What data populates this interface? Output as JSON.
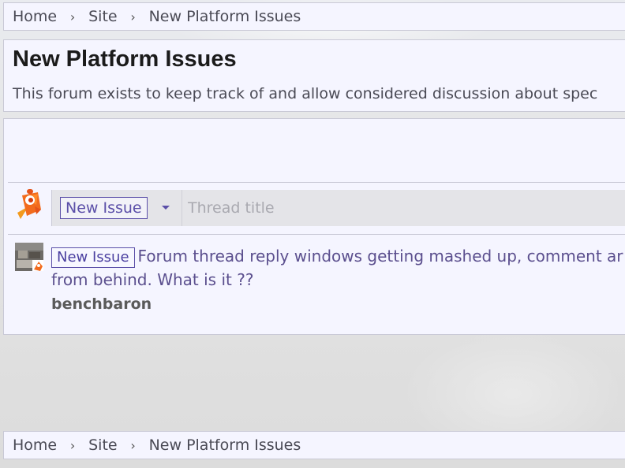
{
  "breadcrumb": {
    "items": [
      "Home",
      "Site",
      "New Platform Issues"
    ],
    "separator": "›"
  },
  "header": {
    "title": "New Platform Issues",
    "description": "This forum exists to keep track of and allow considered discussion about spec"
  },
  "composer": {
    "prefix_label": "New Issue",
    "title_placeholder": "Thread title",
    "avatar_icon": "orange-bird-icon"
  },
  "thread": {
    "prefix": "New Issue",
    "title_line1": "Forum thread reply windows getting mashed up, comment ar",
    "title_line2": "from behind. What is it ??",
    "author": "benchbaron"
  },
  "colors": {
    "panel_bg": "#f5f5ff",
    "border": "#c9c9d6",
    "accent": "#5b4fa8",
    "link_text": "#5b4f8e"
  }
}
